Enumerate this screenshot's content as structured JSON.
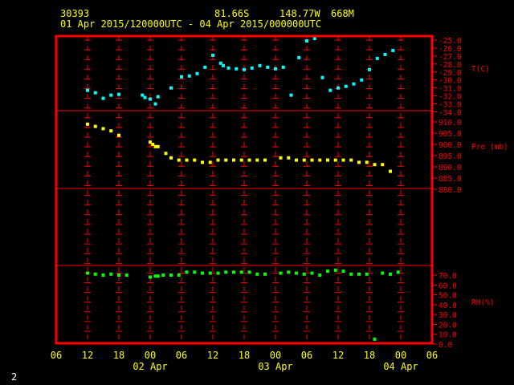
{
  "header": {
    "station": "30393",
    "lat": "81.66S",
    "lon": "148.77W",
    "elev": "668M",
    "period": "01 Apr 2015/120000UTC - 04 Apr 2015/000000UTC"
  },
  "page_number": "2",
  "colors": {
    "frame": "#ff0000",
    "grid": "#ff0000",
    "text": "#ffff00",
    "temp": "#00ffff",
    "pressure": "#ffff00",
    "rh": "#00ff00",
    "page_number": "#ffffff"
  },
  "chart_data": {
    "type": "scatter",
    "x_unit": "hours since 01 Apr 2015 00UTC",
    "x_range": [
      6,
      78
    ],
    "x_ticks": [
      "06",
      "12",
      "18",
      "00",
      "06",
      "12",
      "18",
      "00",
      "06",
      "12",
      "18",
      "00",
      "06"
    ],
    "date_labels": [
      "02 Apr",
      "03 Apr",
      "04 Apr"
    ],
    "grid": true,
    "panels": [
      {
        "name": "temperature",
        "label": "T(C)",
        "ylim": [
          -34,
          -25
        ],
        "yticks": [
          "-25.0",
          "-26.0",
          "-27.0",
          "-28.0",
          "-29.0",
          "-30.0",
          "-31.0",
          "-32.0",
          "-33.0",
          "-34.0"
        ],
        "series": {
          "x": [
            12,
            13.5,
            15,
            16.5,
            18,
            22.5,
            23,
            24,
            25,
            25.5,
            28,
            30,
            31.5,
            33,
            34.5,
            36,
            37.5,
            38,
            39,
            40.5,
            42,
            43.5,
            45,
            46.5,
            48,
            49.5,
            51,
            52.5,
            54,
            55.5,
            57,
            58.5,
            60,
            61.5,
            63,
            64.5,
            66,
            67.5,
            69,
            70.5
          ],
          "y": [
            -31.3,
            -31.6,
            -32.3,
            -31.9,
            -31.8,
            -31.9,
            -32.2,
            -32.4,
            -33.0,
            -32.1,
            -31.0,
            -29.6,
            -29.5,
            -29.2,
            -28.4,
            -26.9,
            -27.9,
            -28.2,
            -28.5,
            -28.6,
            -28.7,
            -28.5,
            -28.2,
            -28.4,
            -28.6,
            -28.4,
            -31.9,
            -27.2,
            -25.1,
            -24.8,
            -29.7,
            -31.3,
            -31.0,
            -30.8,
            -30.5,
            -30.0,
            -28.7,
            -27.3,
            -26.8,
            -26.3
          ]
        }
      },
      {
        "name": "pressure",
        "label": "Pre (mb)",
        "ylim": [
          880,
          910
        ],
        "yticks": [
          "910.0",
          "905.0",
          "900.0",
          "895.0",
          "890.0",
          "885.0",
          "880.0"
        ],
        "series": {
          "x": [
            12,
            13.5,
            15,
            16.5,
            18,
            24,
            24.5,
            25,
            25.5,
            27,
            28,
            29.5,
            31,
            32.5,
            34,
            35.5,
            37,
            38.5,
            40,
            41.5,
            43,
            44.5,
            46,
            49,
            50.5,
            52,
            53.5,
            55,
            56.5,
            58,
            59.5,
            61,
            62.5,
            64,
            65.5,
            67,
            68.5,
            70
          ],
          "y": [
            909.0,
            908.0,
            907.0,
            906.0,
            904.0,
            901.0,
            900.0,
            899.0,
            899.0,
            896.0,
            894.0,
            893.0,
            893.0,
            893.0,
            892.0,
            892.0,
            893.0,
            893.0,
            893.0,
            893.0,
            893.0,
            893.0,
            893.0,
            894.0,
            894.0,
            893.0,
            893.0,
            893.0,
            893.0,
            893.0,
            893.0,
            893.0,
            893.0,
            892.0,
            892.0,
            891.0,
            891.0,
            888.0
          ]
        }
      },
      {
        "name": "rh",
        "label": "RH(%)",
        "ylim": [
          0,
          70
        ],
        "yticks": [
          "70.0",
          "60.0",
          "50.0",
          "40.0",
          "30.0",
          "20.0",
          "10.0",
          "0.0"
        ],
        "series": {
          "x": [
            12,
            13.5,
            15,
            16.5,
            18,
            19.5,
            24,
            25,
            25.5,
            26.5,
            28,
            29.5,
            31,
            32.5,
            34,
            35.5,
            37,
            38.5,
            40,
            41.5,
            43,
            44.5,
            46,
            49,
            50.5,
            52,
            53.5,
            55,
            56.5,
            58,
            59.5,
            61,
            62.5,
            64,
            65.5,
            67,
            68.5,
            70,
            71.5
          ],
          "y": [
            72,
            71,
            70,
            71,
            70,
            70,
            68,
            69,
            69,
            70,
            70,
            70,
            73,
            73,
            72,
            72,
            72,
            73,
            73,
            73,
            73,
            71,
            71,
            72,
            73,
            72,
            71,
            72,
            70,
            74,
            75,
            74,
            71,
            71,
            71,
            5,
            72,
            71,
            73
          ]
        }
      }
    ]
  }
}
